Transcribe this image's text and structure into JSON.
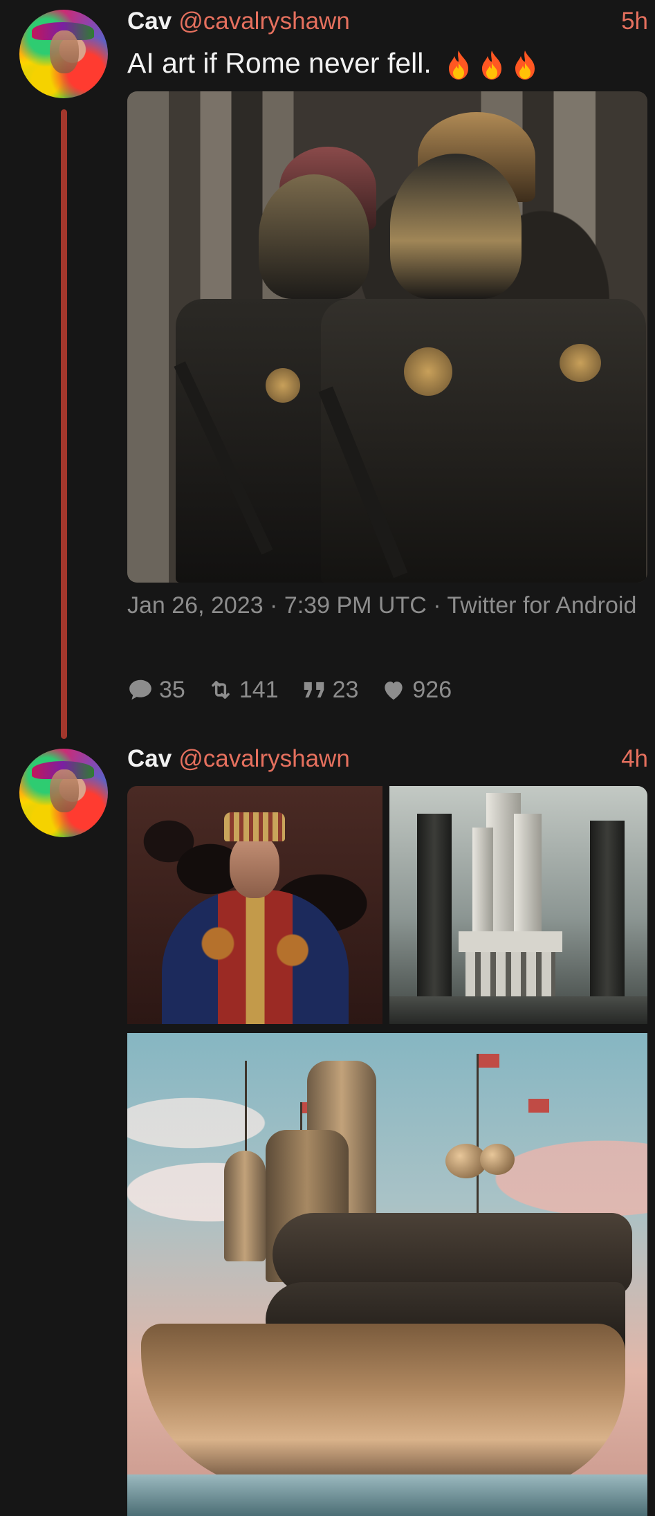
{
  "tweets": [
    {
      "display_name": "Cav",
      "handle": "@cavalryshawn",
      "time_ago": "5h",
      "text": "AI art if Rome never fell.",
      "emoji_icons": [
        "fire-icon",
        "fire-icon",
        "fire-icon"
      ],
      "timestamp_line": "Jan 26, 2023 · 7:39 PM UTC · Twitter for Android",
      "stats": {
        "replies": "35",
        "retweets": "141",
        "quotes": "23",
        "likes": "926"
      }
    },
    {
      "display_name": "Cav",
      "handle": "@cavalryshawn",
      "time_ago": "4h"
    }
  ],
  "colors": {
    "background": "#161616",
    "accent": "#e5705e",
    "thread_line": "#a3372c",
    "muted_text": "#8d8d8d"
  }
}
